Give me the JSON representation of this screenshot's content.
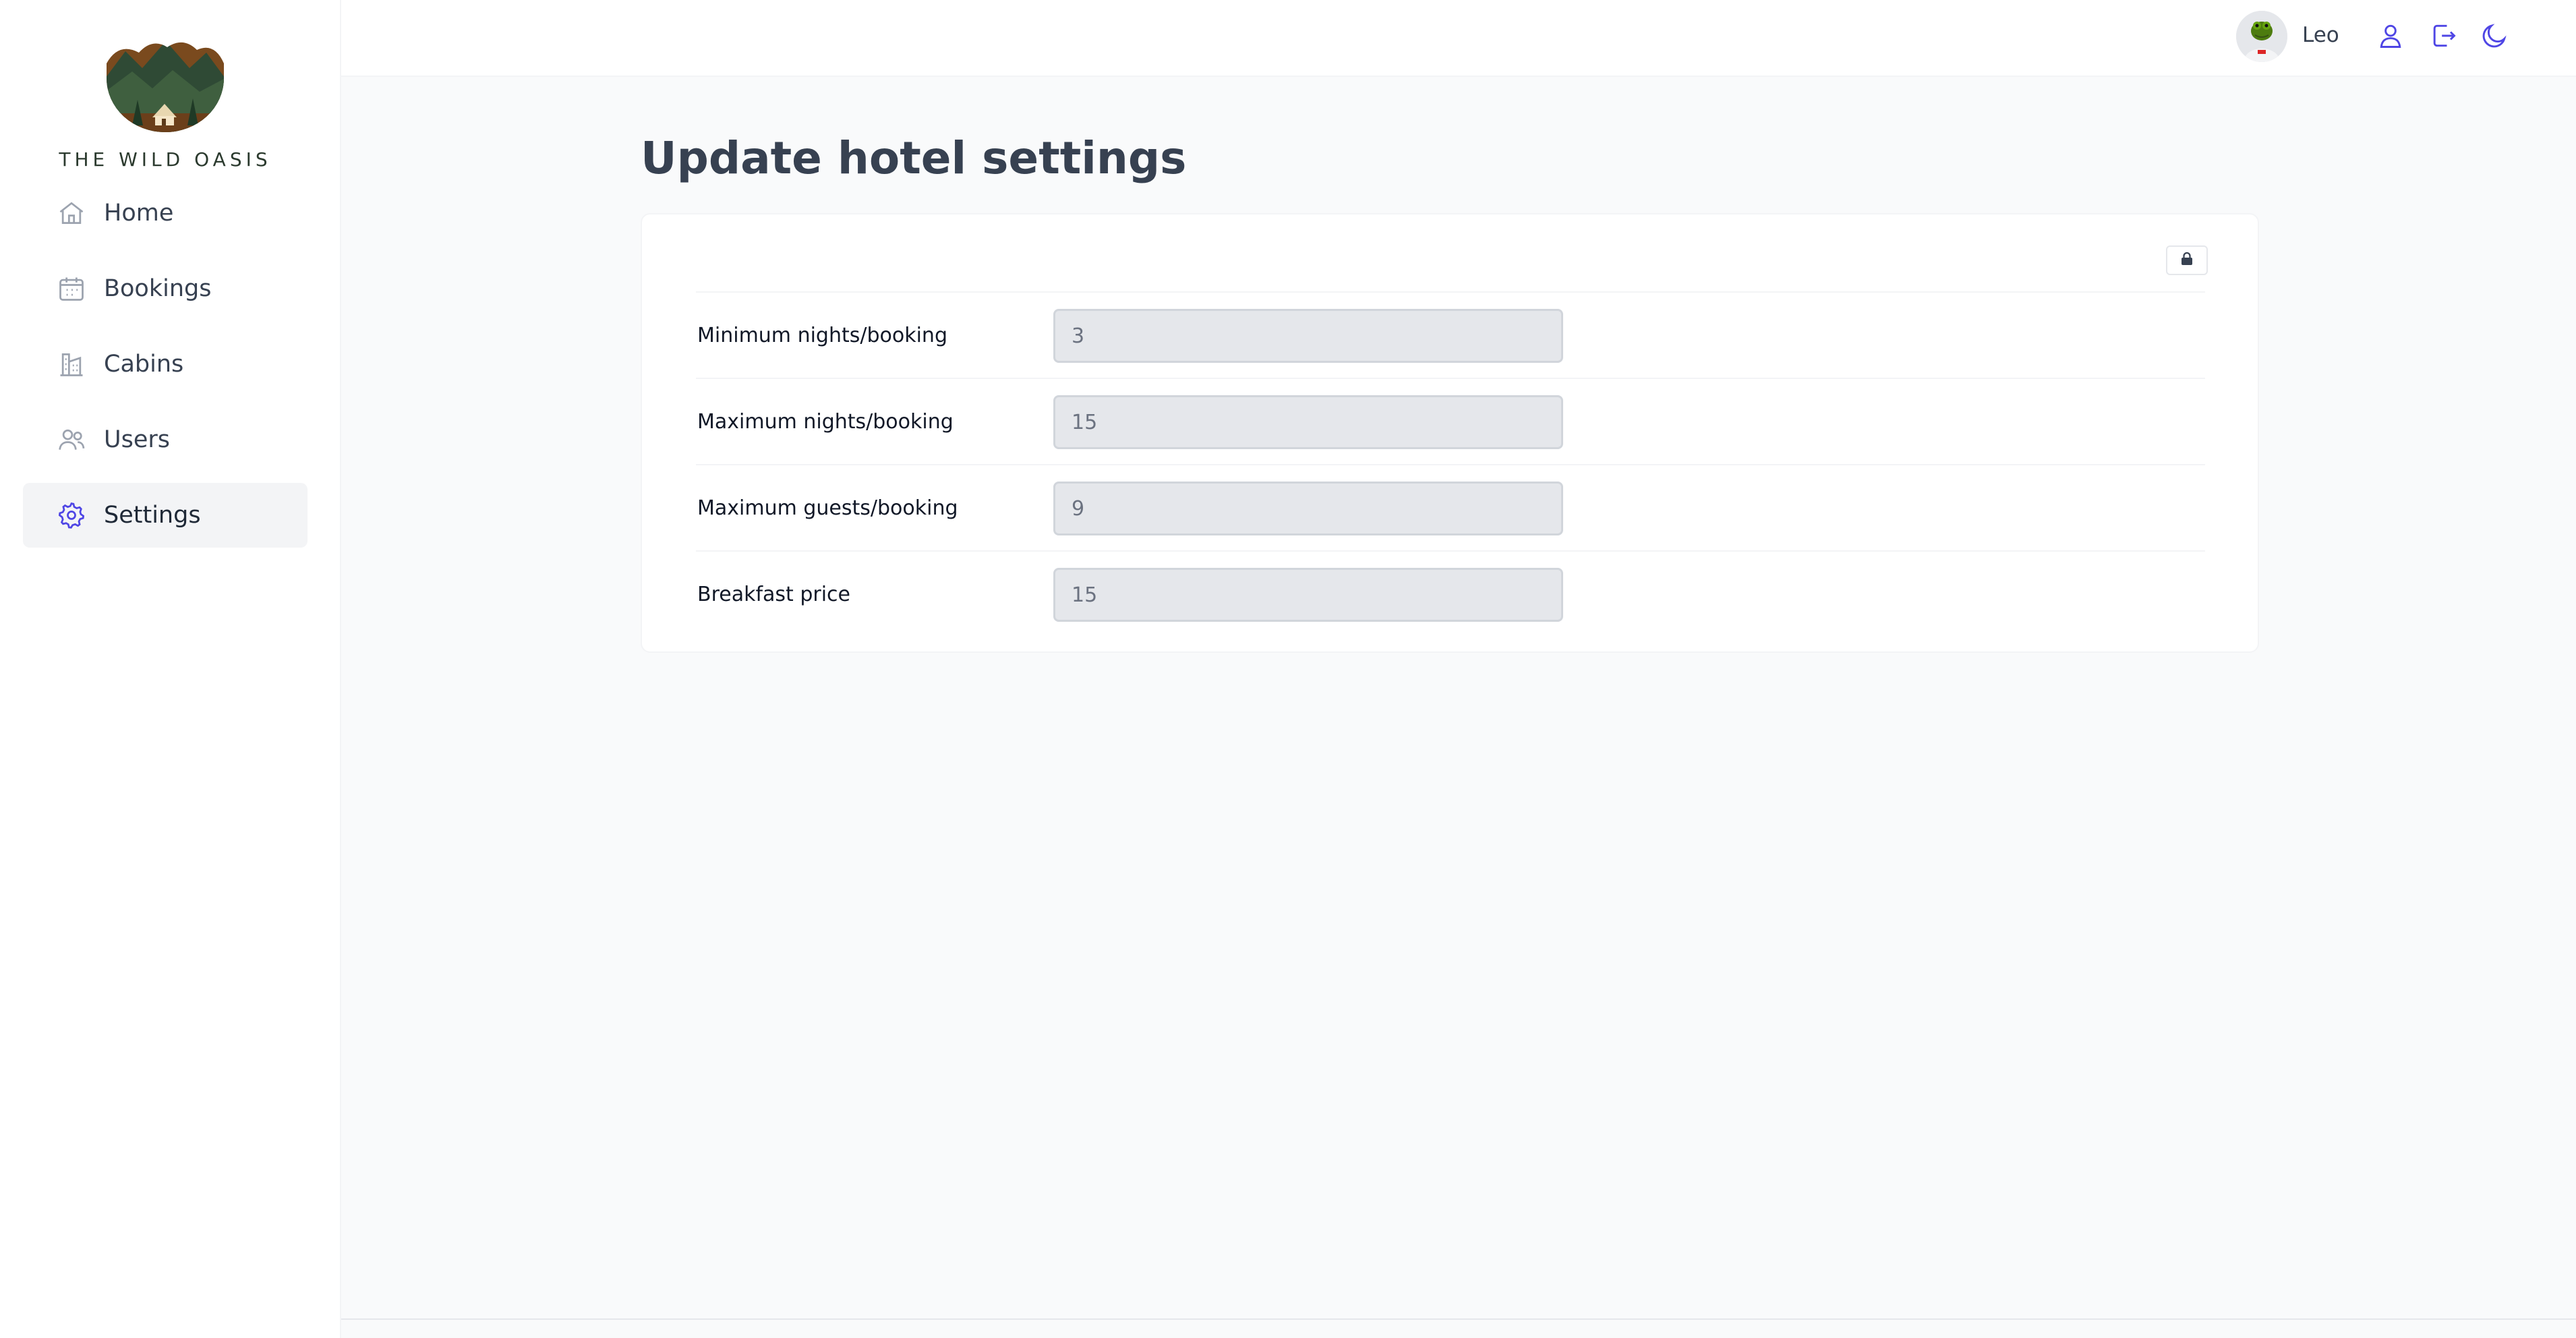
{
  "brand": {
    "name": "THE WILD OASIS"
  },
  "sidebar": {
    "items": [
      {
        "label": "Home",
        "icon": "home-icon",
        "active": false
      },
      {
        "label": "Bookings",
        "icon": "calendar-icon",
        "active": false
      },
      {
        "label": "Cabins",
        "icon": "building-icon",
        "active": false
      },
      {
        "label": "Users",
        "icon": "users-icon",
        "active": false
      },
      {
        "label": "Settings",
        "icon": "gear-icon",
        "active": true
      }
    ]
  },
  "header": {
    "username": "Leo",
    "buttons": [
      "user-icon",
      "logout-icon",
      "moon-icon"
    ]
  },
  "page": {
    "title": "Update hotel settings"
  },
  "settings": {
    "lock_icon": "lock-icon",
    "fields": [
      {
        "label": "Minimum nights/booking",
        "value": "3"
      },
      {
        "label": "Maximum nights/booking",
        "value": "15"
      },
      {
        "label": "Maximum guests/booking",
        "value": "9"
      },
      {
        "label": "Breakfast price",
        "value": "15"
      }
    ]
  },
  "colors": {
    "accent": "#4f46e5",
    "icon_gray": "#9ca3af",
    "input_bg": "#e5e7eb",
    "background": "#f9fafb"
  }
}
